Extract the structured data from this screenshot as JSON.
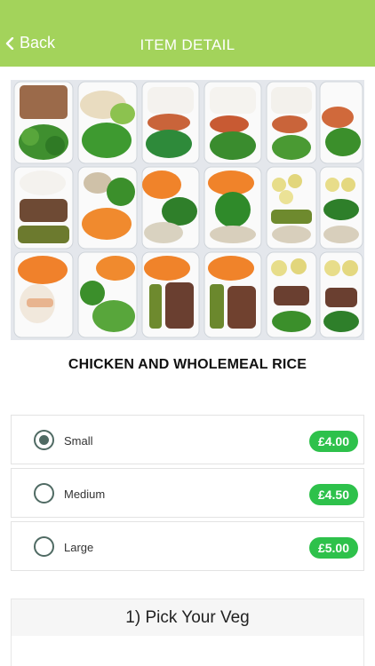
{
  "header": {
    "back_label": "Back",
    "title": "ITEM DETAIL",
    "background_color": "#a3d35b"
  },
  "item": {
    "name": "CHICKEN AND WHOLEMEAL RICE"
  },
  "sizes": [
    {
      "label": "Small",
      "price": "£4.00",
      "selected": true
    },
    {
      "label": "Medium",
      "price": "£4.50",
      "selected": false
    },
    {
      "label": "Large",
      "price": "£5.00",
      "selected": false
    }
  ],
  "sections": [
    {
      "title": "1) Pick Your Veg"
    }
  ],
  "colors": {
    "price_badge": "#2ec14b",
    "radio": "#4f6a63"
  }
}
